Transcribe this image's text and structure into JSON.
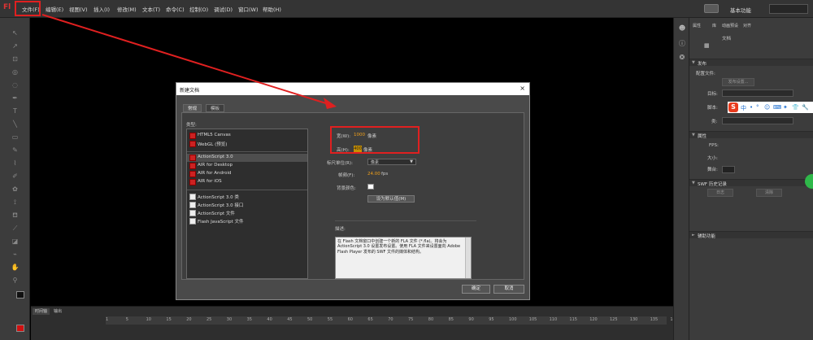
{
  "app": {
    "logo": "Fl"
  },
  "menus": [
    "文件(F)",
    "编辑(E)",
    "视图(V)",
    "插入(I)",
    "修改(M)",
    "文本(T)",
    "命令(C)",
    "控制(O)",
    "调试(D)",
    "窗口(W)",
    "帮助(H)"
  ],
  "workspace": {
    "label": "基本功能"
  },
  "timeline": {
    "tabs": [
      "时间轴",
      "输出"
    ],
    "frames": [
      "1",
      "5",
      "10",
      "15",
      "20",
      "25",
      "30",
      "35",
      "40",
      "45",
      "50",
      "55",
      "60",
      "65",
      "70",
      "75",
      "80",
      "85",
      "90",
      "95",
      "100",
      "105",
      "110",
      "115",
      "120",
      "125",
      "130",
      "135",
      "140"
    ]
  },
  "icon_strip": {
    "icons": [
      "person-icon",
      "info-icon",
      "palette-icon"
    ]
  },
  "properties": {
    "tabs": [
      "属性",
      "库",
      "动画预设",
      "对齐"
    ],
    "doc_label": "文档",
    "publish_section": "发布",
    "profile_label": "配置文件:",
    "publish_settings_btn": "发布设置...",
    "target_label": "目标:",
    "script_label": "脚本:",
    "class_label": "类:",
    "props_section": "属性",
    "fps_label": "FPS:",
    "size_label": "大小:",
    "stage_label": "舞台:",
    "swf_history_section": "SWF 历史记录",
    "log_btn": "日志",
    "clear_btn": "清除",
    "accessibility_section": "辅助功能"
  },
  "ime": {
    "logo": "S",
    "items": [
      "中",
      "•",
      "°",
      "☺",
      "⌨",
      "✦",
      "👕",
      "🔧"
    ]
  },
  "dialog": {
    "title": "新建文档",
    "close": "×",
    "tabs": [
      "常规",
      "模板"
    ],
    "type_label": "类型:",
    "types_group1": [
      "HTML5 Canvas",
      "WebGL (预览)"
    ],
    "types_group2": [
      "ActionScript 3.0",
      "AIR for Desktop",
      "AIR for Android",
      "AIR for iOS"
    ],
    "types_group3": [
      "ActionScript 3.0 类",
      "ActionScript 3.0 接口",
      "ActionScript 文件",
      "Flash JavaScript 文件"
    ],
    "width_label": "宽(W):",
    "width_value": "1000",
    "width_unit": "像素",
    "height_label": "高(H):",
    "height_value": "400",
    "height_unit": "像素",
    "ruler_label": "标尺单位(R):",
    "ruler_value": "像素",
    "fps_label": "帧频(F):",
    "fps_value": "24.00",
    "fps_unit": "fps",
    "bg_label": "背景颜色:",
    "default_btn": "设为默认值(M)",
    "desc_label": "描述:",
    "desc_text": "在 Flash 文档窗口中创建一个新的 FLA 文件 (*.fla)。将会为 ActionScript 3.0 设置发布设置。使用 FLA 文件来设置面向 Adobe Flash Player 发布的 SWF 文件的媒体和结构。",
    "ok": "确定",
    "cancel": "取消"
  },
  "colors": {
    "annotation": "#e02020",
    "accent": "#f0a01a",
    "fill": "#d01010"
  }
}
